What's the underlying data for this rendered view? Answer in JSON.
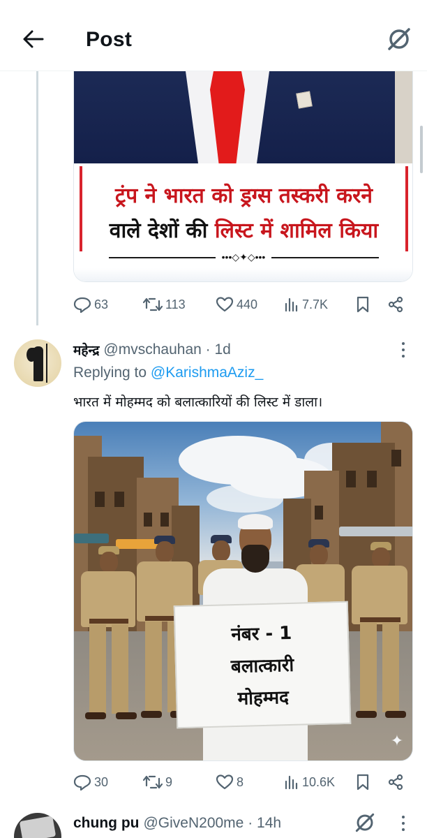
{
  "header": {
    "title": "Post"
  },
  "first_post": {
    "image_headline_line1": "ट्रंप ने भारत को ड्रग्स तस्करी करने",
    "image_headline_line2_part1": "वाले देशों की ",
    "image_headline_line2_part2": "लिस्ट में शामिल किया",
    "stats": {
      "replies": "63",
      "reposts": "113",
      "likes": "440",
      "views": "7.7K"
    }
  },
  "reply_post": {
    "author_name": "महेन्द्र",
    "handle_time": "@mvschauhan · 1d",
    "replying_prefix": "Replying to ",
    "replying_to": "@KarishmaAziz_",
    "text": "भारत में मोहम्मद को बलात्कारियों की लिस्ट में डाला।",
    "image_placard_line1": "नंबर - 1",
    "image_placard_line2": "बलात्कारी",
    "image_placard_line3": "मोहम्मद",
    "stats": {
      "replies": "30",
      "reposts": "9",
      "likes": "8",
      "views": "10.6K"
    }
  },
  "next_post": {
    "author_name": "chung pu",
    "handle_time": "@GiveN200me · 14h"
  },
  "icons": {
    "back": "arrow-left-icon",
    "grok": "grok-icon",
    "reply": "reply-icon",
    "repost": "repost-icon",
    "like": "heart-icon",
    "views": "views-icon",
    "bookmark": "bookmark-icon",
    "share": "share-icon",
    "more": "more-vertical-icon"
  },
  "colors": {
    "link": "#1d9bf0",
    "muted": "#536471",
    "text": "#0f1419",
    "headline_red": "#c8161d"
  }
}
